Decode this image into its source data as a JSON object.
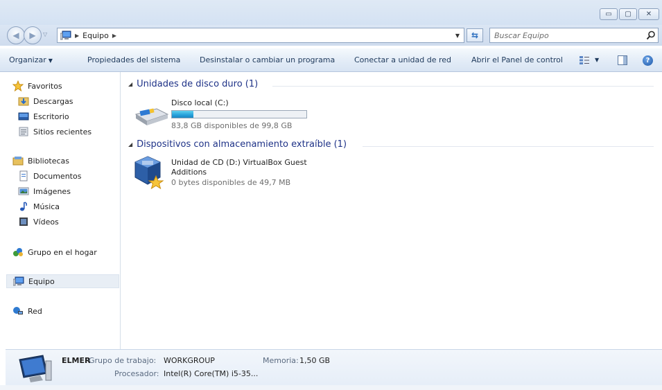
{
  "window": {
    "minimize_glyph": "▭",
    "maximize_glyph": "▢",
    "close_glyph": "✕"
  },
  "address_bar": {
    "path": [
      "Equipo"
    ],
    "search_placeholder": "Buscar Equipo"
  },
  "command_bar": {
    "organize": "Organizar",
    "system_properties": "Propiedades del sistema",
    "uninstall": "Desinstalar o cambiar un programa",
    "map_drive": "Conectar a unidad de red",
    "control_panel": "Abrir el Panel de control",
    "help_glyph": "?"
  },
  "nav_pane": {
    "favorites": "Favoritos",
    "downloads": "Descargas",
    "desktop": "Escritorio",
    "recent": "Sitios recientes",
    "libraries": "Bibliotecas",
    "documents": "Documentos",
    "pictures": "Imágenes",
    "music": "Música",
    "videos": "Vídeos",
    "homegroup": "Grupo en el hogar",
    "computer": "Equipo",
    "network": "Red"
  },
  "groups": {
    "hard_disks": {
      "header": "Unidades de disco duro (1)",
      "drives": [
        {
          "name": "Disco local (C:)",
          "free_text": "83,8 GB disponibles de 99,8 GB",
          "used_fraction": 0.16
        }
      ]
    },
    "removable": {
      "header": "Dispositivos con almacenamiento extraíble (1)",
      "drives": [
        {
          "name_line1": "Unidad de CD (D:) VirtualBox Guest",
          "name_line2": "Additions",
          "free_text": "0 bytes disponibles de 49,7 MB"
        }
      ]
    }
  },
  "details": {
    "computer_name": "ELMER",
    "workgroup_label": "Grupo de trabajo:",
    "workgroup_value": "WORKGROUP",
    "memory_label": "Memoria:",
    "memory_value": "1,50 GB",
    "processor_label": "Procesador:",
    "processor_value": "Intel(R) Core(TM) i5-35..."
  },
  "colors": {
    "group_header": "#1e3287",
    "capacity_fill": "#26a0da",
    "command_text": "#1e395b"
  }
}
